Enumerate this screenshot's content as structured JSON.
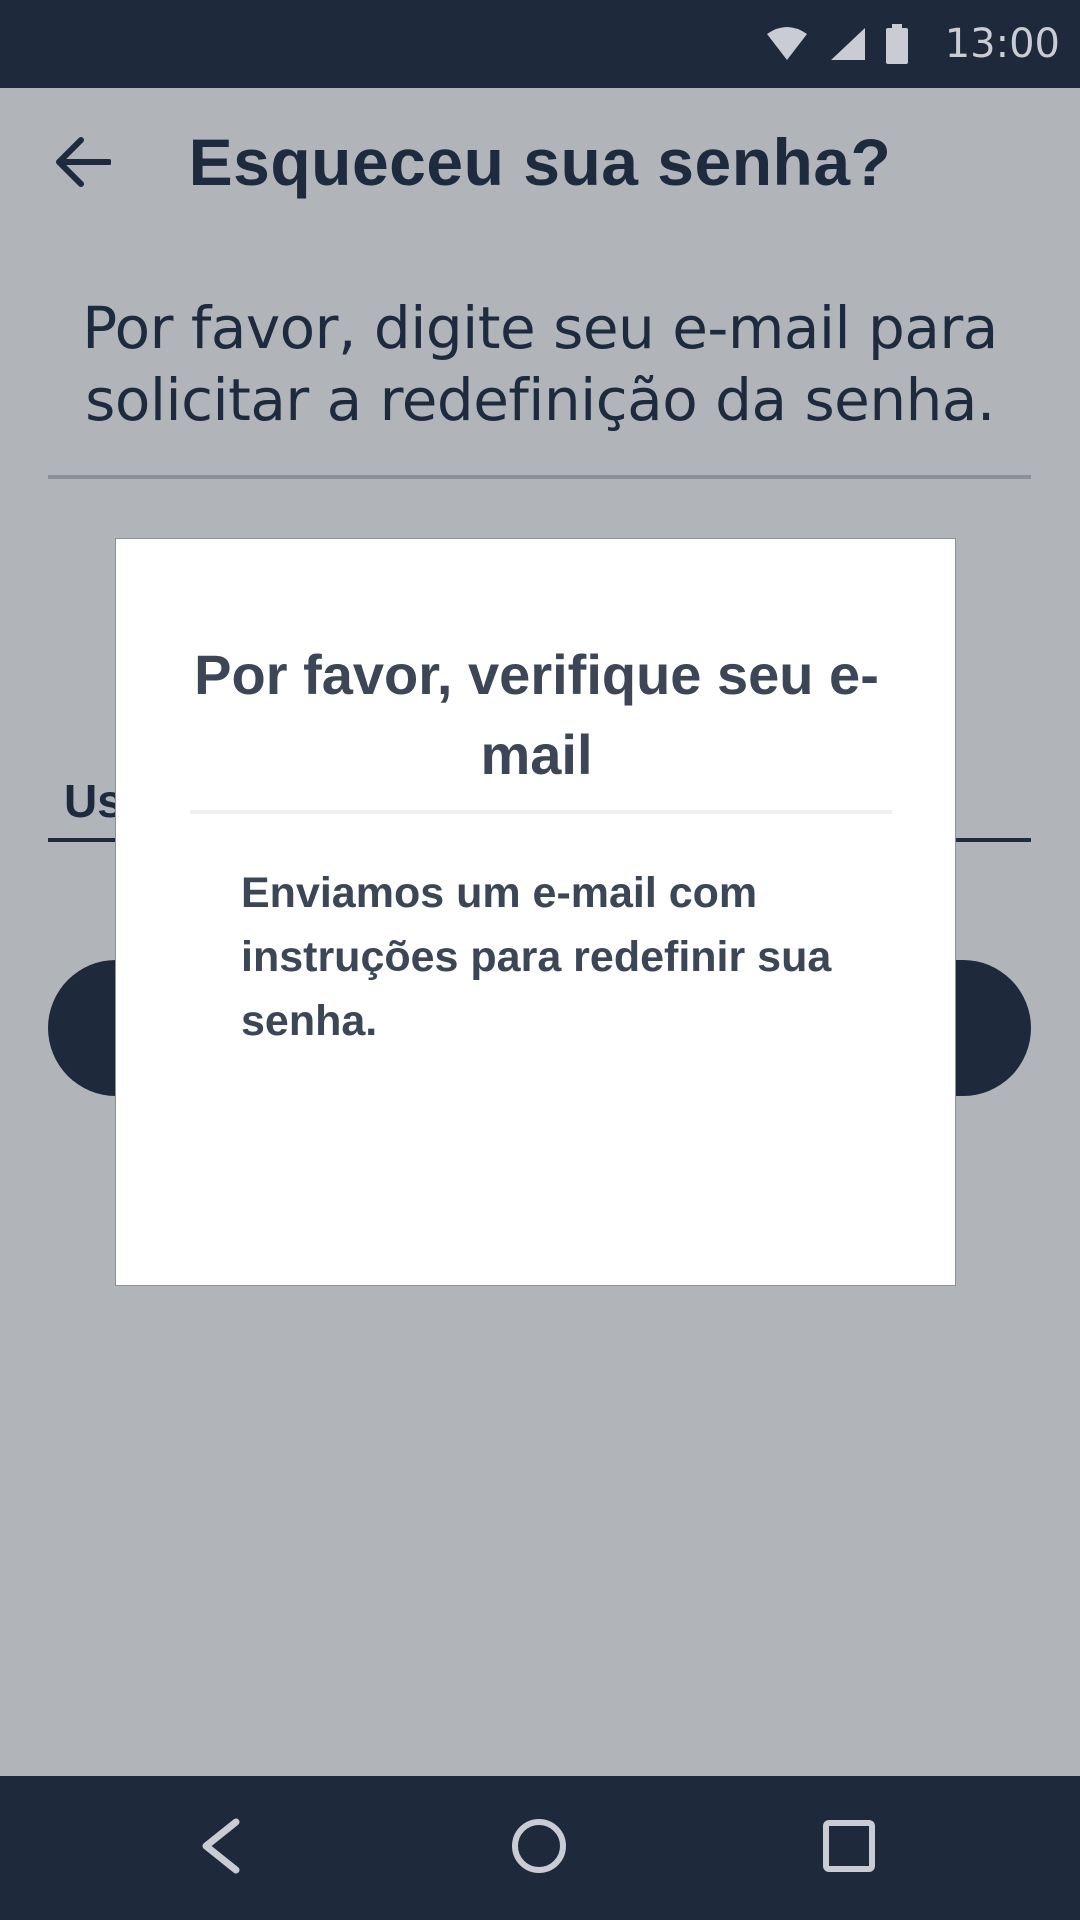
{
  "status_bar": {
    "time": "13:00",
    "icons": [
      "wifi-icon",
      "signal-icon",
      "battery-icon"
    ]
  },
  "header": {
    "title": "Esqueceu sua senha?",
    "back_icon": "arrow-left-icon"
  },
  "main": {
    "instructions": "Por favor, digite seu e-mail para solicitar a redefinição da senha.",
    "email_field_label_visible": "Us"
  },
  "dialog": {
    "title": "Por favor, verifique seu e-mail",
    "body": "Enviamos um e-mail com instruções para redefinir sua senha."
  },
  "nav_bar": {
    "icons": [
      "nav-back-icon",
      "nav-home-icon",
      "nav-recents-icon"
    ]
  },
  "colors": {
    "dark_navy": "#1e293b",
    "scrim_background": "#b1b4b9",
    "dialog_text": "#3c4656",
    "dialog_background": "#ffffff"
  }
}
